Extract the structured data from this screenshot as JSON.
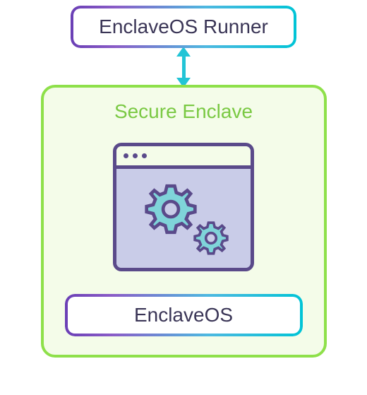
{
  "runner": {
    "label": "EnclaveOS Runner"
  },
  "enclave": {
    "title": "Secure Enclave"
  },
  "os": {
    "label": "EnclaveOS"
  },
  "colors": {
    "green_border": "#8ee04a",
    "green_fill": "#f4fce9",
    "arrow": "#22c4d6",
    "purple": "#5a4a8a",
    "gradient_start": "#6a3fb5",
    "gradient_end": "#00c4d6"
  }
}
